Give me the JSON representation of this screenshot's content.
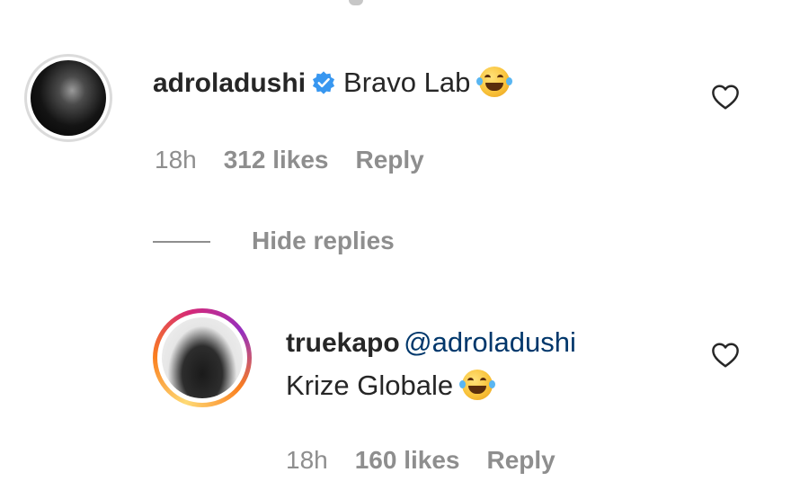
{
  "comments": [
    {
      "username": "adroladushi",
      "verified": true,
      "text": "Bravo Lab",
      "emoji": "face-with-tears-of-joy",
      "time": "18h",
      "likes": "312 likes",
      "reply_label": "Reply"
    }
  ],
  "replies_toggle": {
    "label": "Hide replies"
  },
  "replies": [
    {
      "username": "truekapo",
      "mention": "@adroladushi",
      "text": "Krize Globale",
      "emoji": "face-with-tears-of-joy",
      "time": "18h",
      "likes": "160 likes",
      "reply_label": "Reply"
    }
  ],
  "colors": {
    "text": "#262626",
    "muted": "#8e8e8e",
    "mention": "#00376b",
    "verified": "#3897f0"
  },
  "icons": {
    "verified": "verified-badge-icon",
    "like": "heart-outline-icon",
    "emoji": "face-with-tears-of-joy-icon"
  }
}
